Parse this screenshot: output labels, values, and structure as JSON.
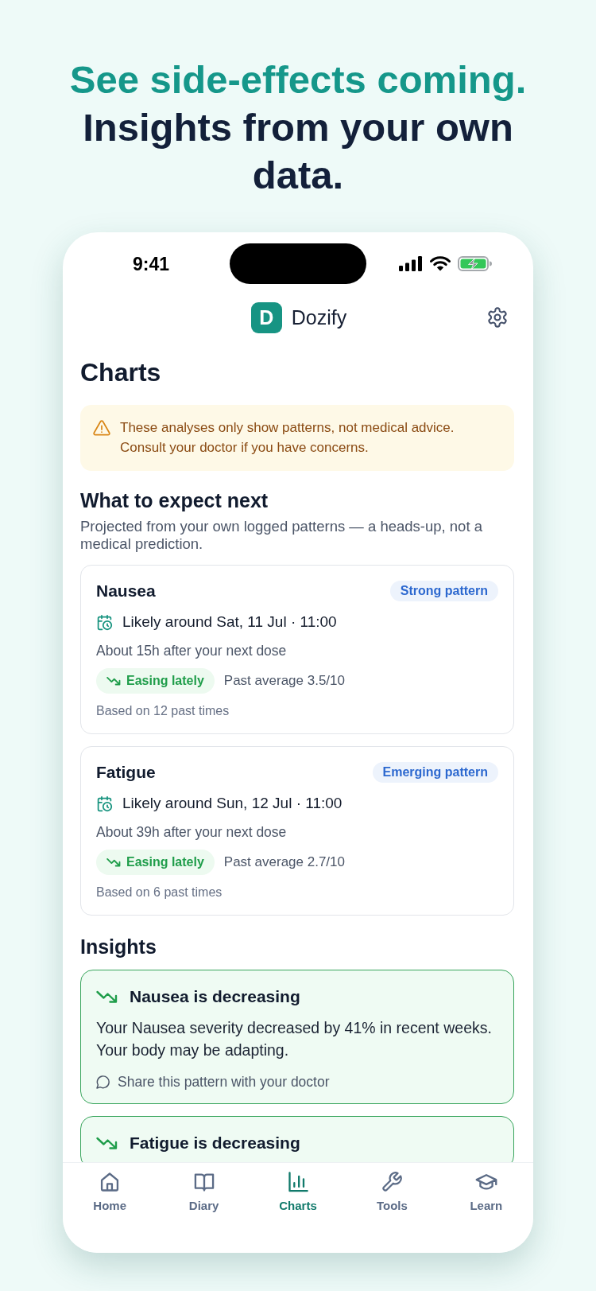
{
  "headline": {
    "accent": "See side-effects coming.",
    "text": "Insights from your own data."
  },
  "status_bar": {
    "time": "9:41"
  },
  "header": {
    "logo_letter": "D",
    "app_name": "Dozify"
  },
  "page_title": "Charts",
  "notice": {
    "lines": [
      "These analyses only show patterns, not medical advice.",
      "Consult your doctor if you have concerns."
    ]
  },
  "forecast": {
    "title": "What to expect next",
    "subtitle": "Projected from your own logged patterns — a heads-up, not a medical prediction.",
    "cards": [
      {
        "symptom": "Nausea",
        "strength": "Strong pattern",
        "when": "Likely around Sat, 11 Jul · 11:00",
        "offset": "About 15h after your next dose",
        "trend": "Easing lately",
        "average": "Past average 3.5/10",
        "basis": "Based on 12 past times"
      },
      {
        "symptom": "Fatigue",
        "strength": "Emerging pattern",
        "when": "Likely around Sun, 12 Jul · 11:00",
        "offset": "About 39h after your next dose",
        "trend": "Easing lately",
        "average": "Past average 2.7/10",
        "basis": "Based on 6 past times"
      }
    ]
  },
  "insights": {
    "title": "Insights",
    "items": [
      {
        "title": "Nausea is decreasing",
        "body": [
          "Your Nausea severity decreased by 41% in recent weeks.",
          "Your body may be adapting."
        ],
        "action": "Share this pattern with your doctor"
      },
      {
        "title": "Fatigue is decreasing"
      }
    ]
  },
  "tab_bar": [
    {
      "label": "Home",
      "selected": false
    },
    {
      "label": "Diary",
      "selected": false
    },
    {
      "label": "Charts",
      "selected": true
    },
    {
      "label": "Tools",
      "selected": false
    },
    {
      "label": "Learn",
      "selected": false
    }
  ]
}
